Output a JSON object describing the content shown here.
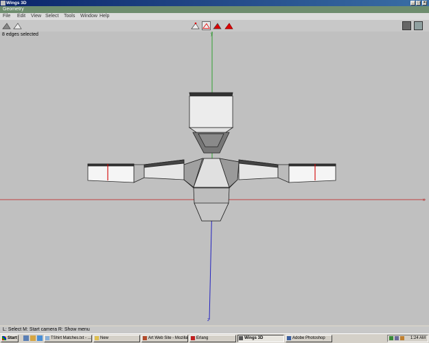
{
  "window": {
    "title": "Wings 3D"
  },
  "geometry_bar": {
    "label": "Geometry"
  },
  "menu": [
    "File",
    "Edit",
    "View",
    "Select",
    "Tools",
    "Window",
    "Help"
  ],
  "viewport": {
    "selection_status": "8 edges selected",
    "axis_labels": {
      "y": "y",
      "z": "z",
      "x": "x"
    },
    "colors": {
      "background": "#c0c0c0",
      "x_axis": "#b03030",
      "y_axis": "#30a030",
      "z_axis": "#2020c0",
      "selected_edge": "#d00000"
    }
  },
  "status_line": "L: Select   M: Start camera   R: Show menu",
  "taskbar": {
    "start_label": "Start",
    "tasks": [
      {
        "label": "TShirt Matches.txt - ...",
        "icon": "notepad-icon",
        "active": false
      },
      {
        "label": "New",
        "icon": "folder-icon",
        "active": false
      },
      {
        "label": "Art Web Site - Mozilla",
        "icon": "mozilla-icon",
        "active": false
      },
      {
        "label": "Erlang",
        "icon": "erlang-icon",
        "active": false
      },
      {
        "label": "Wings 3D",
        "icon": "wings-icon",
        "active": true
      },
      {
        "label": "Adobe Photoshop",
        "icon": "photoshop-icon",
        "active": false
      }
    ],
    "clock": "1:24 AM"
  }
}
